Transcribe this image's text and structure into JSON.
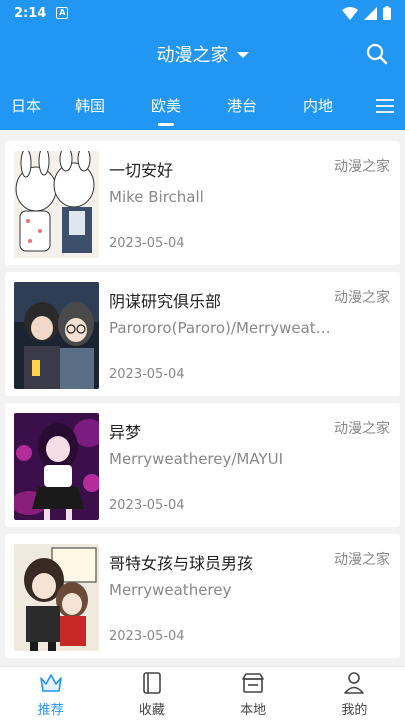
{
  "status_bar": {
    "time": "2:14",
    "app_icon_letter": "A"
  },
  "header": {
    "title": "动漫之家"
  },
  "tabs": [
    {
      "label": "日本",
      "active": false
    },
    {
      "label": "韩国",
      "active": false
    },
    {
      "label": "欧美",
      "active": true
    },
    {
      "label": "港台",
      "active": false
    },
    {
      "label": "内地",
      "active": false
    }
  ],
  "items": [
    {
      "title": "一切安好",
      "author": "Mike Birchall",
      "date": "2023-05-04",
      "source": "动漫之家"
    },
    {
      "title": "阴谋研究俱乐部",
      "author": "Parororo(Paroro)/Merryweatherey",
      "date": "2023-05-04",
      "source": "动漫之家"
    },
    {
      "title": "异梦",
      "author": "Merryweatherey/MAYUI",
      "date": "2023-05-04",
      "source": "动漫之家"
    },
    {
      "title": "哥特女孩与球员男孩",
      "author": "Merryweatherey",
      "date": "2023-05-04",
      "source": "动漫之家"
    }
  ],
  "bottom_nav": [
    {
      "label": "推荐",
      "icon": "crown-icon",
      "active": true
    },
    {
      "label": "收藏",
      "icon": "book-icon",
      "active": false
    },
    {
      "label": "本地",
      "icon": "store-icon",
      "active": false
    },
    {
      "label": "我的",
      "icon": "person-icon",
      "active": false
    }
  ],
  "colors": {
    "primary": "#2196f3",
    "card": "#ffffff",
    "muted_text": "#888888"
  }
}
